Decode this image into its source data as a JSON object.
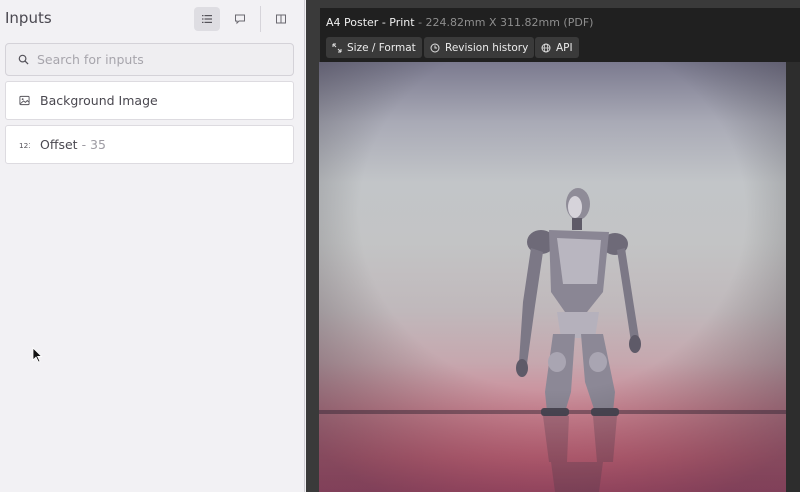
{
  "left_panel": {
    "title": "Inputs",
    "search": {
      "placeholder": "Search for inputs",
      "value": ""
    },
    "toolbar": {
      "list_view_icon": "list-icon",
      "comment_icon": "comment-icon",
      "split_view_icon": "split-view-icon"
    },
    "inputs": [
      {
        "label": "Background Image",
        "value": "",
        "icon": "image-icon"
      },
      {
        "label": "Offset",
        "value": "- 35",
        "icon": "number-icon"
      }
    ]
  },
  "document": {
    "title": "A4 Poster - Print",
    "subtitle": " - 224.82mm X 311.82mm (PDF)",
    "buttons": [
      {
        "label": "Size / Format",
        "icon": "resize-icon"
      },
      {
        "label": "Revision history",
        "icon": "clock-icon"
      },
      {
        "label": "API",
        "icon": "globe-icon"
      }
    ],
    "poster": {
      "subject": "robot figure",
      "icon": "poster-image"
    }
  },
  "colors": {
    "panel_bg": "#f2f1f4",
    "canvas_bg": "#3a3a3a",
    "header_bg": "#202020",
    "chip_bg": "#3a3a3a",
    "text_primary": "#4a4850",
    "text_muted": "#9d9ba3"
  }
}
